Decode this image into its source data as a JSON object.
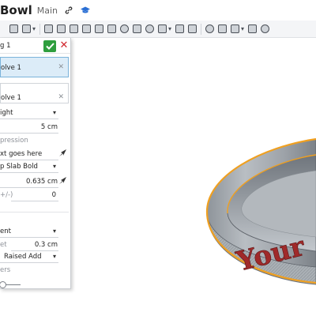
{
  "document": {
    "title": "Bowl",
    "branch": "Main"
  },
  "toolbar": {
    "icons": [
      "sketch-icon",
      "extrude-icon",
      "revolve-icon",
      "sweep-icon",
      "loft-icon",
      "thicken-icon",
      "fillet-icon",
      "chamfer-icon",
      "draft-icon",
      "shell-icon",
      "hole-icon",
      "pattern-icon",
      "mirror-icon",
      "boolean-icon",
      "split-icon",
      "transform-icon",
      "plane-icon",
      "mate-connector-icon",
      "section-icon"
    ]
  },
  "feature_dialog": {
    "title": "g 1",
    "confirm_label": "✓",
    "cancel_label": "✕",
    "face_selection": "olve 1",
    "secondary_selection": "olve 1",
    "height_mode": "ight",
    "height_value": "5 cm",
    "expression_label": "pression",
    "text_value": "xt goes here",
    "font": "p Slab Bold",
    "size_value": "0.635 cm",
    "offset_label": "+/-)",
    "offset_value": "0",
    "alignment": "ent",
    "depth_label": "et",
    "depth_value": "0.3 cm",
    "operation": "Raised Add",
    "layers_label": "ers",
    "slider_level": 0.1
  },
  "model": {
    "engraved_text": "Your",
    "highlight_color": "#f0a020",
    "text_color": "#a02a2a",
    "bowl_color": "#aeb3b8"
  }
}
